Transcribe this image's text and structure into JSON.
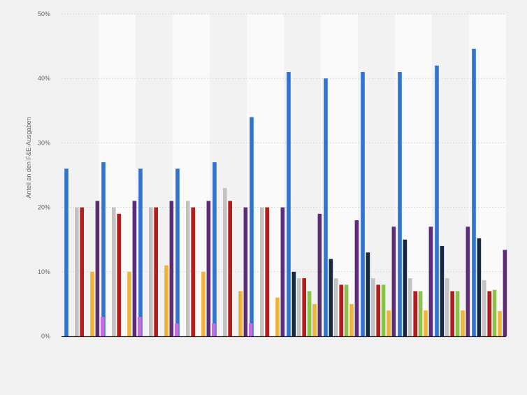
{
  "chart_data": {
    "type": "bar",
    "title": "",
    "xlabel": "",
    "ylabel": "Anteil an den F&E-Ausgaben",
    "ylim": [
      0,
      50
    ],
    "yticks": [
      "0%",
      "10%",
      "20%",
      "30%",
      "40%",
      "50%"
    ],
    "categories": [
      "",
      "",
      "",
      "",
      "",
      "",
      "",
      "",
      "",
      "",
      "",
      ""
    ],
    "grid": true,
    "legend": "none",
    "series": [
      {
        "color": "#2f74d3",
        "values": [
          26,
          27,
          26,
          26,
          27,
          34,
          41,
          40,
          41,
          41,
          42,
          44.6
        ]
      },
      {
        "color": "#14293f",
        "values": [
          null,
          null,
          null,
          null,
          null,
          null,
          10,
          12,
          13,
          15,
          14,
          15.2
        ]
      },
      {
        "color": "#c3c3c3",
        "values": [
          20,
          20,
          20,
          21,
          23,
          20,
          9,
          9,
          9,
          9,
          9,
          8.7
        ]
      },
      {
        "color": "#b71c1c",
        "values": [
          20,
          19,
          20,
          20,
          21,
          20,
          9,
          8,
          8,
          7,
          7,
          7
        ]
      },
      {
        "color": "#8bc34a",
        "values": [
          null,
          null,
          null,
          null,
          null,
          null,
          7,
          8,
          8,
          7,
          7,
          7.2
        ]
      },
      {
        "color": "#f0b33a",
        "values": [
          10,
          10,
          11,
          10,
          7,
          6,
          5,
          5,
          4,
          4,
          4,
          3.9
        ]
      },
      {
        "color": "#5c2d76",
        "values": [
          21,
          21,
          21,
          21,
          20,
          20,
          19,
          18,
          17,
          17,
          17,
          13.4
        ]
      },
      {
        "color": "#c36ddf",
        "values": [
          3,
          3,
          2,
          2,
          2,
          null,
          null,
          null,
          null,
          null,
          null,
          null
        ]
      }
    ]
  }
}
